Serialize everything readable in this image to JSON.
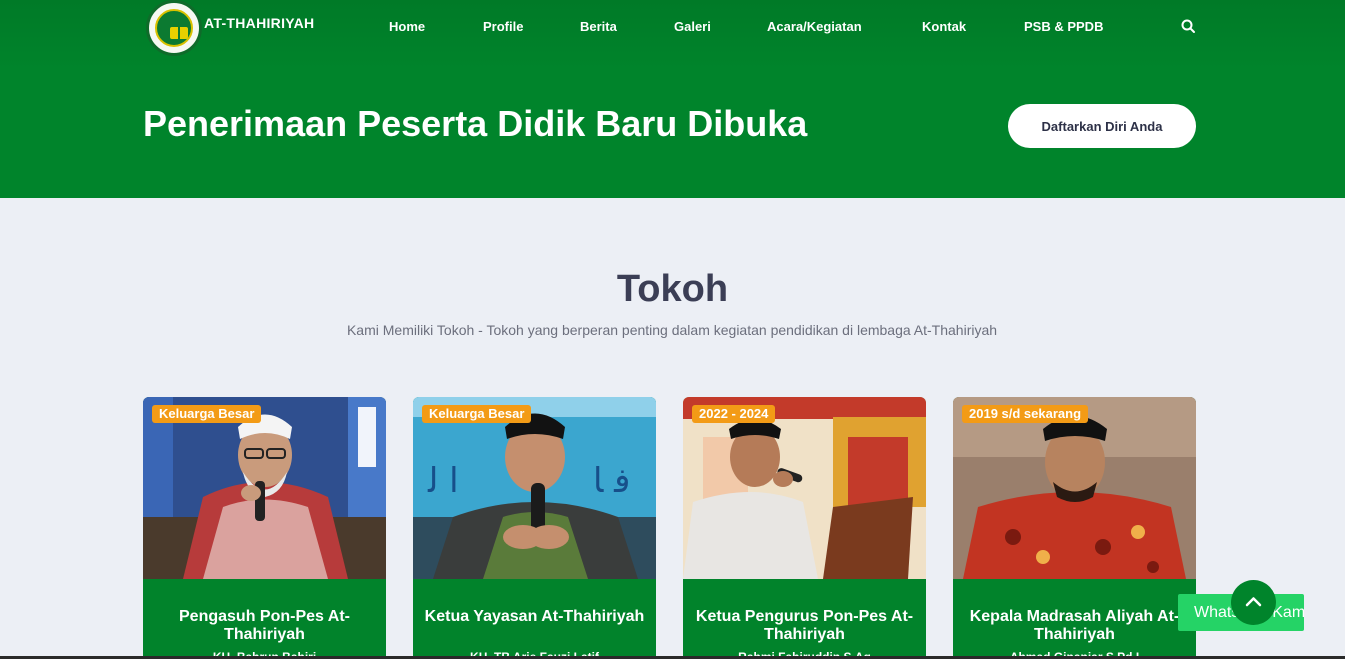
{
  "header": {
    "brand": "AT-THAHIRIYAH",
    "nav": [
      "Home",
      "Profile",
      "Berita",
      "Galeri",
      "Acara/Kegiatan",
      "Kontak",
      "PSB & PPDB"
    ],
    "search_icon": "search-icon"
  },
  "hero": {
    "title": "Penerimaan Peserta Didik Baru Dibuka",
    "cta_label": "Daftarkan Diri Anda"
  },
  "section": {
    "title": "Tokoh",
    "description": "Kami Memiliki Tokoh - Tokoh yang berperan penting dalam kegiatan pendidikan di lembaga At-Thahiriyah"
  },
  "cards": [
    {
      "badge": "Keluarga Besar",
      "title": "Pengasuh Pon-Pes At-Thahiriyah",
      "subtitle": "KH. Bahrun Bahiri"
    },
    {
      "badge": "Keluarga Besar",
      "title": "Ketua Yayasan At-Thahiriyah",
      "subtitle": "KH. TB Arie Fauzi Latif"
    },
    {
      "badge": "2022 - 2024",
      "title": "Ketua Pengurus Pon-Pes At-Thahiriyah",
      "subtitle": "Rahmi Fahiruddin S.Ag"
    },
    {
      "badge": "2019 s/d sekarang",
      "title": "Kepala Madrasah Aliyah At-Thahiriyah",
      "subtitle": "Ahmad Ginanjar S.Pd.I"
    }
  ],
  "floating": {
    "whatsapp_label": "WhatsApp Kami",
    "to_top_icon": "chevron-up-icon"
  },
  "colors": {
    "primary": "#00842b",
    "badge": "#f39b16",
    "background": "#eceff5",
    "heading": "#3b3e55"
  }
}
